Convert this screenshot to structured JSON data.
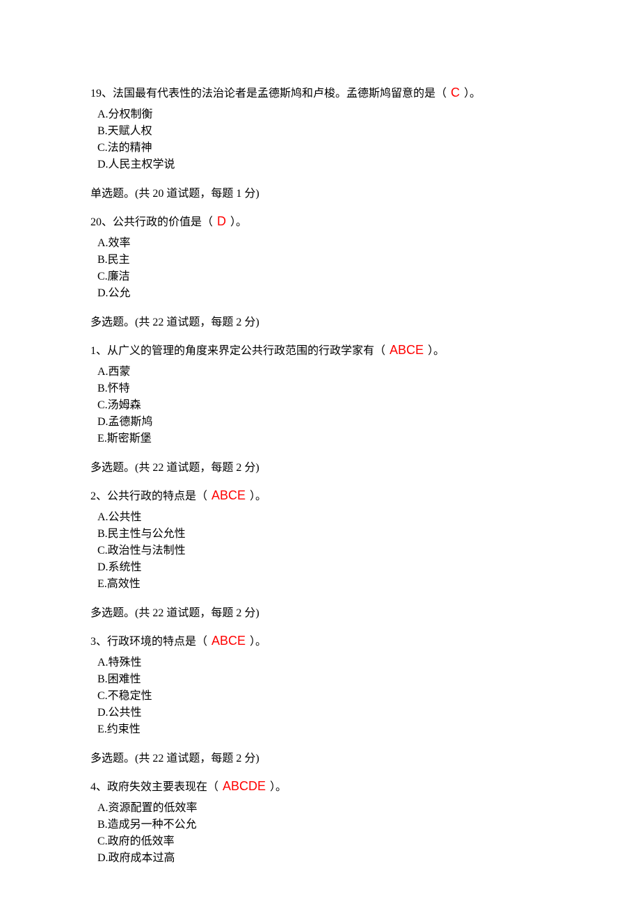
{
  "questions": [
    {
      "number": "19",
      "stem_pre": "、法国最有代表性的法治论者是孟德斯鸠和卢梭。孟德斯鸠留意的是（",
      "answer": "C",
      "stem_post": "）。",
      "options": [
        "A.分权制衡",
        "B.天赋人权",
        "C.法的精神",
        "D.人民主权学说"
      ],
      "note": "单选题。(共 20 道试题，每题 1 分)"
    },
    {
      "number": "20",
      "stem_pre": "、公共行政的价值是（",
      "answer": "D",
      "stem_post": "）。",
      "options": [
        "A.效率",
        "B.民主",
        "C.廉洁",
        "D.公允"
      ],
      "note": "多选题。(共 22 道试题，每题 2 分)"
    },
    {
      "number": "1",
      "stem_pre": "、从广义的管理的角度来界定公共行政范围的行政学家有（",
      "answer": "ABCE",
      "stem_post": "）。",
      "options": [
        "A.西蒙",
        "B.怀特",
        "C.汤姆森",
        "D.孟德斯鸠",
        "E.斯密斯堡"
      ],
      "note": "多选题。(共 22 道试题，每题 2 分)"
    },
    {
      "number": "2",
      "stem_pre": "、公共行政的特点是（",
      "answer": "ABCE",
      "stem_post": "）。",
      "options": [
        "A.公共性",
        "B.民主性与公允性",
        "C.政治性与法制性",
        "D.系统性",
        "E.高效性"
      ],
      "note": "多选题。(共 22 道试题，每题 2 分)"
    },
    {
      "number": "3",
      "stem_pre": "、行政环境的特点是（",
      "answer": "ABCE",
      "stem_post": "）。",
      "options": [
        "A.特殊性",
        "B.困难性",
        "C.不稳定性",
        "D.公共性",
        "E.约束性"
      ],
      "note": "多选题。(共 22 道试题，每题 2 分)"
    },
    {
      "number": "4",
      "stem_pre": "、政府失效主要表现在（",
      "answer": "ABCDE",
      "stem_post": "）。",
      "options": [
        "A.资源配置的低效率",
        "B.造成另一种不公允",
        "C.政府的低效率",
        "D.政府成本过高"
      ],
      "note": ""
    }
  ]
}
